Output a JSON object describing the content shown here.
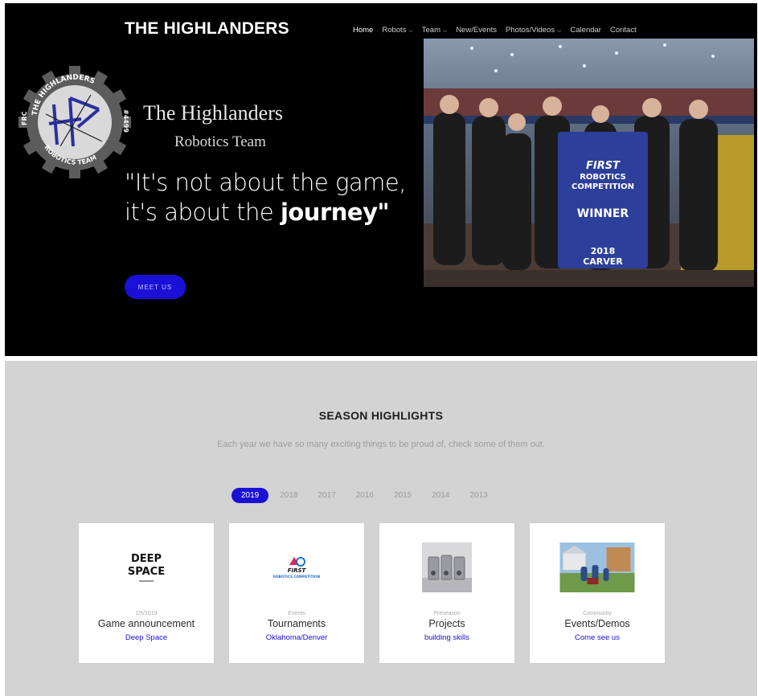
{
  "header": {
    "brand": "THE HIGHLANDERS",
    "nav": [
      {
        "label": "Home",
        "active": true,
        "dropdown": false
      },
      {
        "label": "Robots",
        "active": false,
        "dropdown": true
      },
      {
        "label": "Team",
        "active": false,
        "dropdown": true
      },
      {
        "label": "New/Events",
        "active": false,
        "dropdown": false
      },
      {
        "label": "Photos/Videos",
        "active": false,
        "dropdown": true
      },
      {
        "label": "Calendar",
        "active": false,
        "dropdown": false
      },
      {
        "label": "Contact",
        "active": false,
        "dropdown": false
      }
    ]
  },
  "hero": {
    "logo_top_text": "THE HIGHLANDERS",
    "logo_bottom_text": "ROBOTICS TEAM",
    "logo_left_text": "FRC",
    "logo_right_text": "#4499",
    "title": "The Highlanders",
    "subtitle": "Robotics Team",
    "quote_line1": "\"It's not about the game,",
    "quote_line2_prefix": "it's about the ",
    "quote_line2_bold": "journey\"",
    "cta_label": "MEET US",
    "photo_banner_lines": [
      "FIRST",
      "ROBOTICS",
      "COMPETITION",
      "WINNER",
      "2018",
      "CARVER"
    ]
  },
  "highlights": {
    "title": "SEASON HIGHLIGHTS",
    "description": "Each year we have so many exciting things to be proud of, check some of them out.",
    "years": [
      "2019",
      "2018",
      "2017",
      "2016",
      "2015",
      "2014",
      "2013"
    ],
    "active_year": "2019",
    "cards": [
      {
        "meta": "1/5/2019",
        "title": "Game announcement",
        "link": "Deep Space",
        "image": "deep-space-logo",
        "logo_line1": "DEEP",
        "logo_line2": "SPACE"
      },
      {
        "meta": "Events",
        "title": "Tournaments",
        "link": "Oklahoma/Denver",
        "image": "first-robotics-logo",
        "logo_line1": "FIRST",
        "logo_line2": "ROBOTICS COMPETITION"
      },
      {
        "meta": "Preseason",
        "title": "Projects",
        "link": "building skills",
        "image": "parts-photo"
      },
      {
        "meta": "Community",
        "title": "Events/Demos",
        "link": "Come see us",
        "image": "demo-photo"
      }
    ]
  },
  "colors": {
    "accent": "#1a10d6",
    "hero_bg": "#000000",
    "section_bg": "#d3d3d3"
  }
}
